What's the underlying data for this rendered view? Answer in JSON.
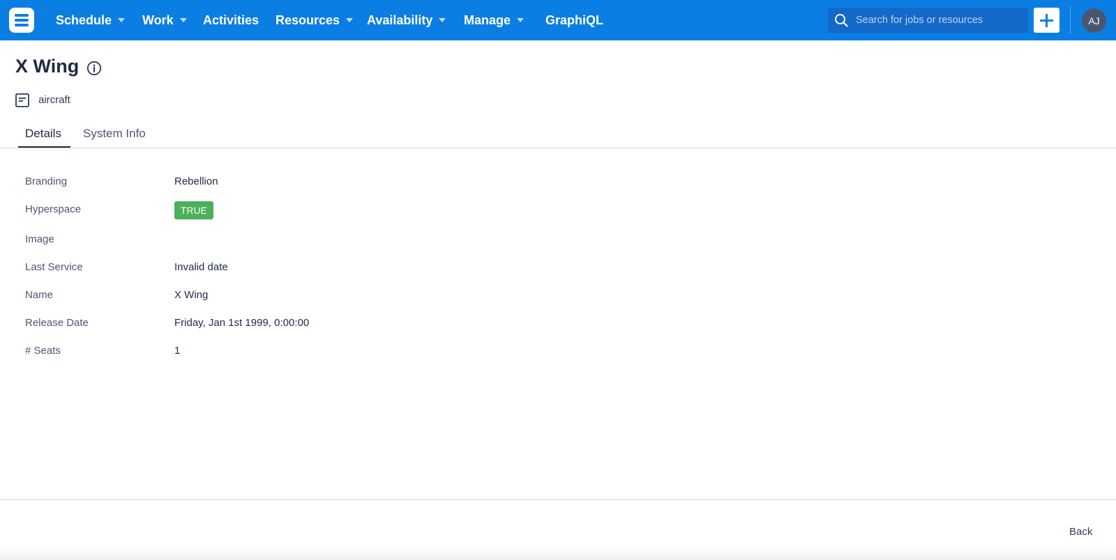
{
  "nav": {
    "items": [
      {
        "label": "Schedule",
        "dropdown": true
      },
      {
        "label": "Work",
        "dropdown": true
      },
      {
        "label": "Activities",
        "dropdown": false
      },
      {
        "label": "Resources",
        "dropdown": true
      },
      {
        "label": "Availability",
        "dropdown": true
      },
      {
        "label": "Manage",
        "dropdown": true
      },
      {
        "label": "GraphiQL",
        "dropdown": false
      }
    ],
    "search_placeholder": "Search for jobs or resources",
    "avatar_initials": "AJ",
    "colors": {
      "bar": "#0b7ee3",
      "search_bg": "#1369c8"
    }
  },
  "header": {
    "title": "X Wing",
    "type_label": "aircraft"
  },
  "tabs": [
    {
      "label": "Details",
      "active": true
    },
    {
      "label": "System Info",
      "active": false
    }
  ],
  "details": [
    {
      "label": "Branding",
      "value": "Rebellion"
    },
    {
      "label": "Hyperspace",
      "value": "TRUE",
      "badge_color": "#4caf5a"
    },
    {
      "label": "Image",
      "value": ""
    },
    {
      "label": "Last Service",
      "value": "Invalid date"
    },
    {
      "label": "Name",
      "value": "X Wing"
    },
    {
      "label": "Release Date",
      "value": "Friday, Jan 1st 1999, 0:00:00"
    },
    {
      "label": "# Seats",
      "value": "1"
    }
  ],
  "footer": {
    "back_label": "Back"
  }
}
